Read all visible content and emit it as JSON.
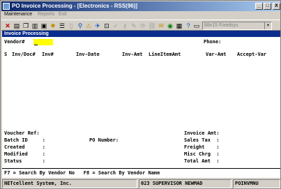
{
  "window": {
    "title": "PO Invoice Processing - [Electronics - RSS(96)]",
    "controls": [
      "_",
      "□",
      "X"
    ]
  },
  "menu": {
    "items": [
      {
        "label": "Maintenance",
        "enabled": true
      },
      {
        "label": "Reports",
        "enabled": false
      },
      {
        "label": "Exit",
        "enabled": false
      }
    ]
  },
  "toolbar": {
    "font_select": "88x15 Fixedsys",
    "icons": [
      "close-x-icon",
      "print-icon",
      "copy-icon",
      "paste-icon",
      "save-icon",
      "settings-icon",
      "notes-icon",
      "search-icon",
      "warning-icon",
      "find-icon",
      "lock-icon",
      "check-icon",
      "key-icon",
      "edit-icon",
      "refresh-icon",
      "link-icon",
      "attach-icon",
      "info-icon",
      "calendar-icon",
      "help-icon",
      "window-icon"
    ]
  },
  "screen": {
    "header": "Invoice Processing",
    "vendor_label": "Vendor#",
    "vendor_value": "",
    "phone_label": "Phone:",
    "columns": {
      "s": "S",
      "inv_doc": "Inv/Doc#",
      "inv_num": "Inv#",
      "inv_date": "Inv-Date",
      "inv_amt": "Inv-Amt",
      "line_item_amt": "LineItemAmt",
      "var_amt": "Var-Amt",
      "accept_var": "Accept-Var"
    },
    "footer_fields": {
      "voucher_ref": "Voucher Ref:",
      "batch_id": "Batch ID     :",
      "created": "Created      :",
      "modified": "Modified     :",
      "status": "Status       :",
      "po_number": "PO Number:",
      "invoice_amt": "Invoice Amt:",
      "sales_tax": "Sales Tax  :",
      "freight": "Freight    :",
      "misc_chrg": "Misc Chrg  :",
      "total_amt": "Total Amt  :"
    },
    "function_keys": "F7 = Search By Vendor No   F8 = Search By Vendor Name"
  },
  "statusbar": {
    "company": "NETcellent System, Inc.",
    "user": "023 SUPERVISOR NEWMAD",
    "program": "POINVMNU"
  }
}
